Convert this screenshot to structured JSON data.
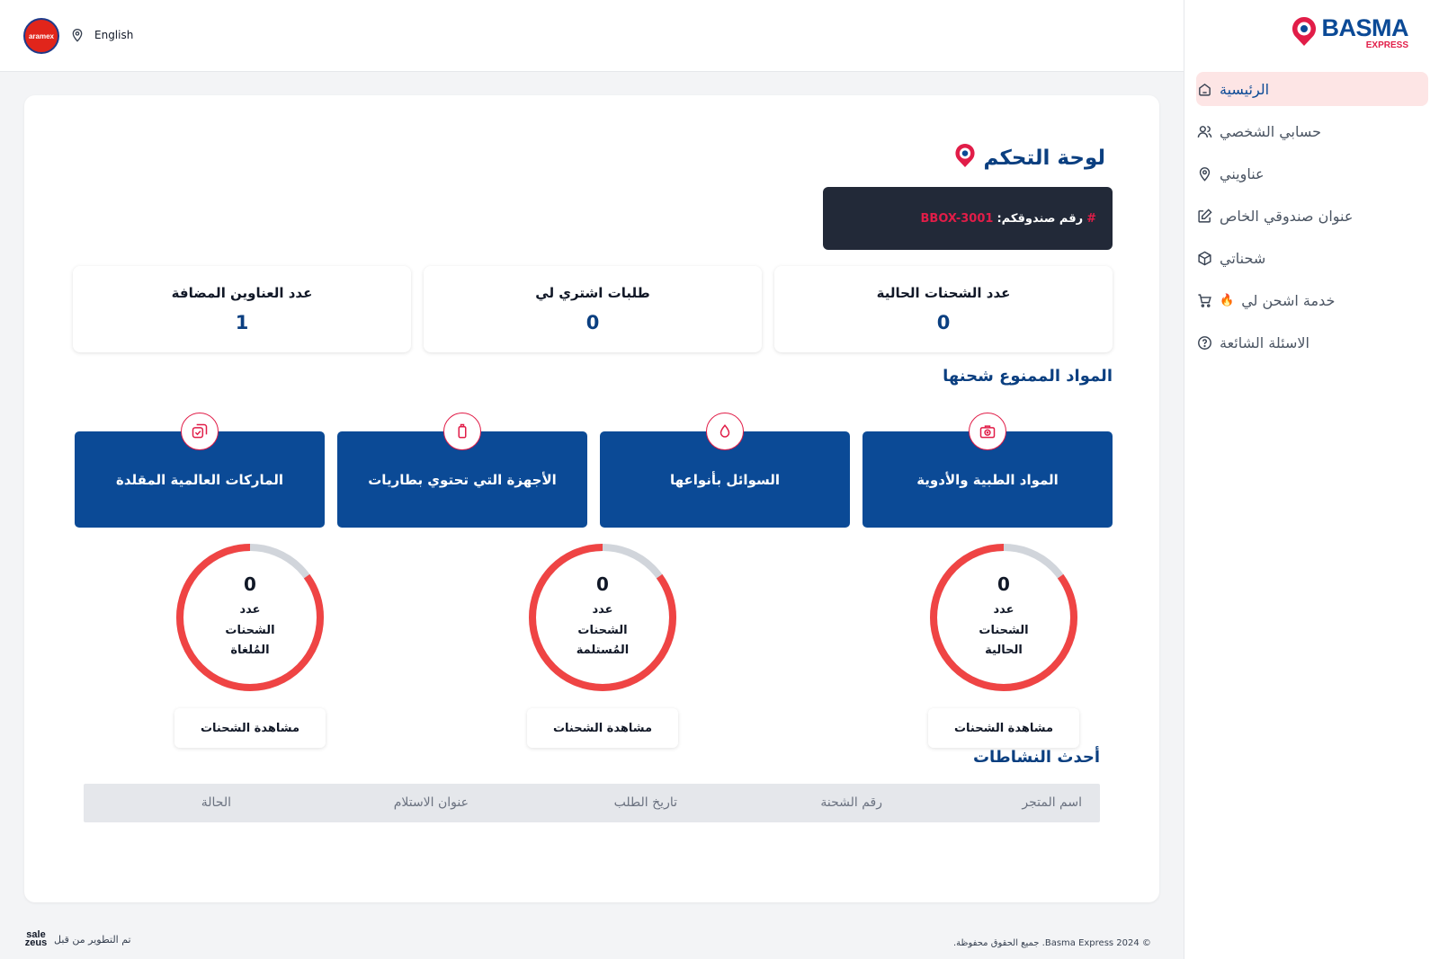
{
  "brand": {
    "name": "BASMA",
    "sub": "EXPRESS",
    "primary": "#0b4a96",
    "accent": "#e11d48"
  },
  "topbar": {
    "partner_logo": "aramex",
    "language": "English",
    "location_icon": "map-pin-icon"
  },
  "sidebar": {
    "items": [
      {
        "label": "الرئيسية",
        "icon": "home-icon",
        "active": true
      },
      {
        "label": "حسابي الشخصي",
        "icon": "users-icon"
      },
      {
        "label": "عناويني",
        "icon": "map-pin-icon"
      },
      {
        "label": "عنوان صندوقي الخاص",
        "icon": "edit-icon"
      },
      {
        "label": "شحناتي",
        "icon": "package-icon"
      },
      {
        "label": "خدمة اشحن لي",
        "icon": "cart-icon",
        "badge": "🔥"
      },
      {
        "label": "الاسئلة الشائعة",
        "icon": "help-icon"
      }
    ]
  },
  "dashboard": {
    "title": "لوحة التحكم",
    "box_label": "رقم صندوقكم:",
    "box_hash": "#",
    "box_number": "BBOX-3001",
    "stats": [
      {
        "label": "عدد الشحنات الحالية",
        "value": "0"
      },
      {
        "label": "طلبات اشتري لي",
        "value": "0"
      },
      {
        "label": "عدد العناوين المضافة",
        "value": "1"
      }
    ],
    "prohibited_title": "المواد الممنوع شحنها",
    "prohibited": [
      {
        "label": "المواد الطبية والأدوية",
        "icon": "medical-kit-icon"
      },
      {
        "label": "السوائل بأنواعها",
        "icon": "droplet-icon"
      },
      {
        "label": "الأجهزة التي تحتوي بطاريات",
        "icon": "battery-icon"
      },
      {
        "label": "الماركات العالمية المقلدة",
        "icon": "copy-check-icon"
      }
    ],
    "rings": [
      {
        "value": "0",
        "label": "عدد الشحنات الحالية",
        "button": "مشاهدة الشحنات",
        "fill": 0.85
      },
      {
        "value": "0",
        "label": "عدد الشحنات المُستلمة",
        "button": "مشاهدة الشحنات",
        "fill": 0.85
      },
      {
        "value": "0",
        "label": "عدد الشحنات المُلغاة",
        "button": "مشاهدة الشحنات",
        "fill": 0.85
      }
    ],
    "activity_title": "أحدث النشاطات",
    "table_columns": [
      "اسم المتجر",
      "رقم الشحنة",
      "تاريخ الطلب",
      "عنوان الاستلام",
      "الحالة"
    ]
  },
  "footer": {
    "developer_label": "تم التطوير من قبل",
    "developer_brand": "sale zeus",
    "copyright": "© Basma Express 2024. جميع الحقوق محفوظة."
  },
  "colors": {
    "ring_filled": "#ef4444",
    "ring_track": "#d1d5db",
    "banner_dark": "#222938"
  }
}
